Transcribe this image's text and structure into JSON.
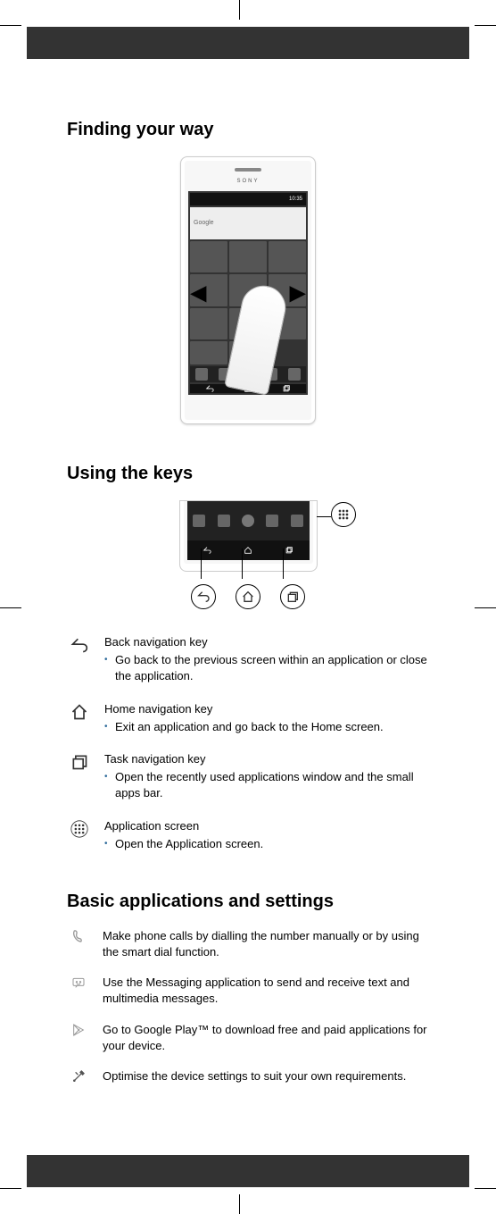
{
  "headings": {
    "finding": "Finding your way",
    "using_keys": "Using the keys",
    "basic_apps": "Basic applications and settings"
  },
  "phone": {
    "brand": "SONY",
    "clock": "10:35",
    "search": "Google"
  },
  "keys": [
    {
      "title": "Back navigation key",
      "bullet": "Go back to the previous screen within an application or close the application."
    },
    {
      "title": "Home navigation key",
      "bullet": "Exit an application and go back to the Home screen."
    },
    {
      "title": "Task navigation key",
      "bullet": "Open the recently used applications window and the small apps bar."
    },
    {
      "title": "Application screen",
      "bullet": "Open the Application screen."
    }
  ],
  "apps": [
    {
      "text": "Make phone calls by dialling the number manually or by using the smart dial function."
    },
    {
      "text": "Use the Messaging application to send and receive text and multimedia messages."
    },
    {
      "text": "Go to Google Play™ to download free and paid applications for your device."
    },
    {
      "text": "Optimise the device settings to suit your own requirements."
    }
  ]
}
